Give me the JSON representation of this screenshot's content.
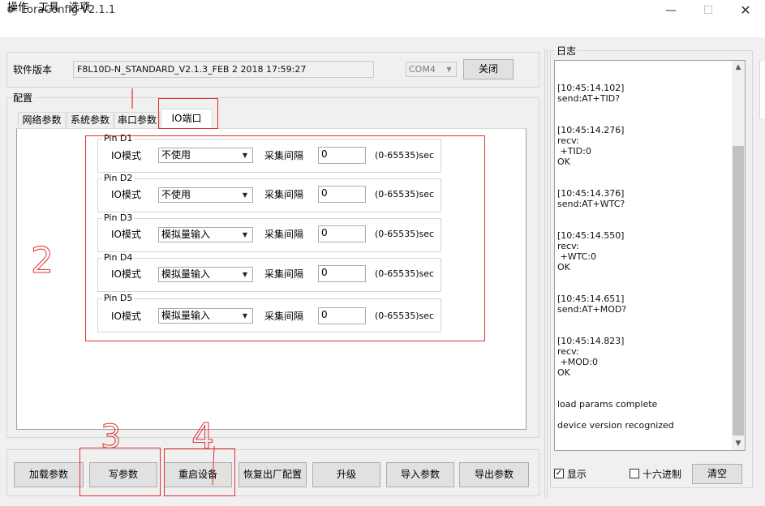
{
  "window": {
    "title": "LoraConfig V2.1.1",
    "min_glyph": "—",
    "max_glyph": "☐",
    "close_glyph": "✕"
  },
  "menu": [
    "操作",
    "工具",
    "选项"
  ],
  "version": {
    "label": "软件版本",
    "value": "F8L10D-N_STANDARD_V2.1.3_FEB  2 2018 17:59:27",
    "port": "COM4",
    "close_label": "关闭"
  },
  "config": {
    "label": "配置",
    "tabs": [
      "网络参数",
      "系统参数",
      "串口参数",
      "IO端口"
    ],
    "active_tab": "IO端口",
    "pins": [
      {
        "name": "Pin D1",
        "io_label": "IO模式",
        "mode": "不使用",
        "interval_label": "采集间隔",
        "interval": "0",
        "range": "(0-65535)sec"
      },
      {
        "name": "Pin D2",
        "io_label": "IO模式",
        "mode": "不使用",
        "interval_label": "采集间隔",
        "interval": "0",
        "range": "(0-65535)sec"
      },
      {
        "name": "Pin D3",
        "io_label": "IO模式",
        "mode": "模拟量输入",
        "interval_label": "采集间隔",
        "interval": "0",
        "range": "(0-65535)sec"
      },
      {
        "name": "Pin D4",
        "io_label": "IO模式",
        "mode": "模拟量输入",
        "interval_label": "采集间隔",
        "interval": "0",
        "range": "(0-65535)sec"
      },
      {
        "name": "Pin D5",
        "io_label": "IO模式",
        "mode": "模拟量输入",
        "interval_label": "采集间隔",
        "interval": "0",
        "range": "(0-65535)sec"
      }
    ]
  },
  "buttons": [
    "加载参数",
    "写参数",
    "重启设备",
    "恢复出厂配置",
    "升级",
    "导入参数",
    "导出参数"
  ],
  "log": {
    "label": "日志",
    "lines": [
      "[10:45:14.102]",
      "send:AT+TID?",
      "[10:45:14.276]",
      "recv:",
      " +TID:0",
      "OK",
      "[10:45:14.376]",
      "send:AT+WTC?",
      "[10:45:14.550]",
      "recv:",
      " +WTC:0",
      "OK",
      "[10:45:14.651]",
      "send:AT+MOD?",
      "[10:45:14.823]",
      "recv:",
      " +MOD:0",
      "OK",
      "load params complete",
      "device version recognized"
    ],
    "show_label": "显示",
    "show_checked": true,
    "hex_label": "十六进制",
    "hex_checked": false,
    "clear_label": "清空"
  },
  "annotations": [
    "2",
    "3",
    "4"
  ],
  "colors": {
    "annotation": "#e03030",
    "accent_bg": "#e1e1e1"
  }
}
